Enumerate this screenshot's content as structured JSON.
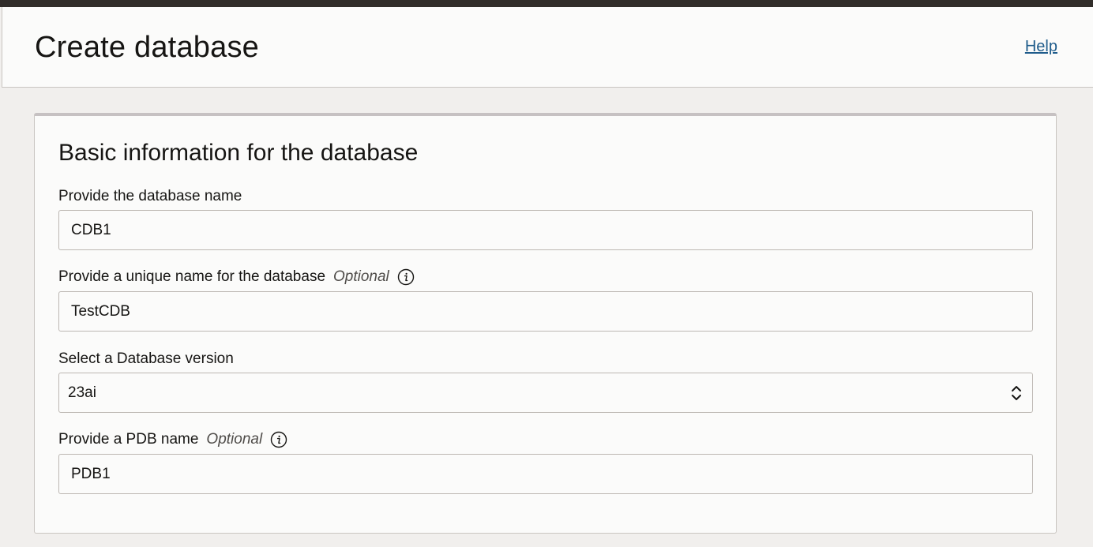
{
  "header": {
    "title": "Create database",
    "help_label": "Help"
  },
  "section": {
    "title": "Basic information for the database"
  },
  "fields": {
    "db_name": {
      "label": "Provide the database name",
      "value": "CDB1"
    },
    "unique_name": {
      "label": "Provide a unique name for the database",
      "optional": "Optional",
      "value": "TestCDB"
    },
    "db_version": {
      "label": "Select a Database version",
      "value": "23ai"
    },
    "pdb_name": {
      "label": "Provide a PDB name",
      "optional": "Optional",
      "value": "PDB1"
    }
  },
  "icons": {
    "info": "info-icon",
    "select_chevron": "chevron-up-down-icon"
  },
  "colors": {
    "topbar": "#312d2a",
    "link": "#1f5c8b",
    "background": "#f1efed",
    "surface": "#fbfbfa"
  }
}
